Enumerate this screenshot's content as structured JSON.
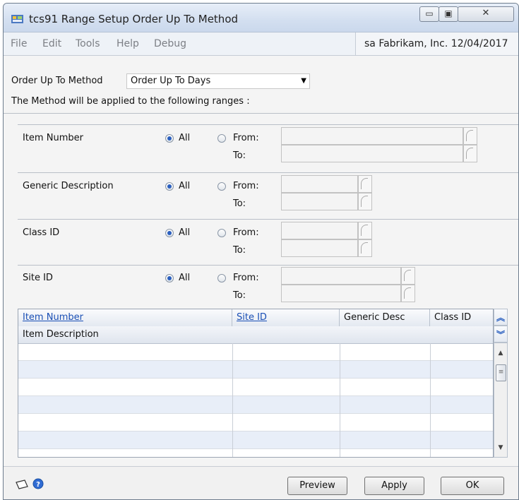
{
  "window": {
    "title": "tcs91 Range Setup Order Up To Method",
    "controls": {
      "minimize": "▭",
      "maximize": "▣",
      "close": "✕"
    }
  },
  "menu": [
    "File",
    "Edit",
    "Tools",
    "Help",
    "Debug"
  ],
  "user_info": "sa  Fabrikam, Inc. 12/04/2017",
  "method": {
    "label": "Order Up To Method",
    "value": "Order Up To Days",
    "note": "The Method will be applied to the following ranges :"
  },
  "ranges": [
    {
      "label": "Item Number",
      "all": "All",
      "from": "From:",
      "to": "To:",
      "selected": "All"
    },
    {
      "label": "Generic Description",
      "all": "All",
      "from": "From:",
      "to": "To:",
      "selected": "All"
    },
    {
      "label": "Class  ID",
      "all": "All",
      "from": "From:",
      "to": "To:",
      "selected": "All"
    },
    {
      "label": "Site ID",
      "all": "All",
      "from": "From:",
      "to": "To:",
      "selected": "All"
    }
  ],
  "grid": {
    "columns": [
      "Item Number",
      "Site ID",
      "Generic Desc",
      "Class ID"
    ],
    "second_row": "Item Description",
    "rows": 6
  },
  "footer": {
    "buttons": [
      "Preview",
      "Apply",
      "OK"
    ]
  },
  "colors": {
    "accent": "#2a5fbf",
    "link": "#1a4fb5",
    "alt_row": "#e8eef8"
  }
}
